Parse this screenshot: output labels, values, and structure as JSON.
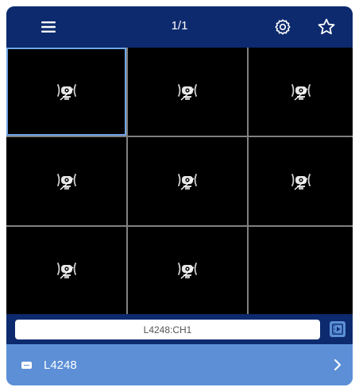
{
  "header": {
    "page_indicator": "1/1",
    "menu_icon": "menu-icon",
    "settings_icon": "gear-icon",
    "favorite_icon": "star-icon"
  },
  "grid": {
    "rows": 3,
    "columns": 3,
    "selected_cell": 1,
    "cells": [
      {
        "has_camera": true
      },
      {
        "has_camera": true
      },
      {
        "has_camera": true
      },
      {
        "has_camera": true
      },
      {
        "has_camera": true
      },
      {
        "has_camera": true
      },
      {
        "has_camera": true
      },
      {
        "has_camera": true
      },
      {
        "has_camera": false
      }
    ],
    "camera_icon": "no-signal-camera-icon"
  },
  "channel_bar": {
    "channel_value": "L4248:CH1",
    "playback_icon": "playback-icon"
  },
  "device_row": {
    "device_name": "L4248",
    "device_icon": "device-icon",
    "chevron_icon": "chevron-right-icon"
  },
  "colors": {
    "header_bg": "#0d2a6e",
    "accent": "#5c8fd6",
    "selected_outline": "#6fa4e8",
    "cell_bg": "#000000"
  }
}
